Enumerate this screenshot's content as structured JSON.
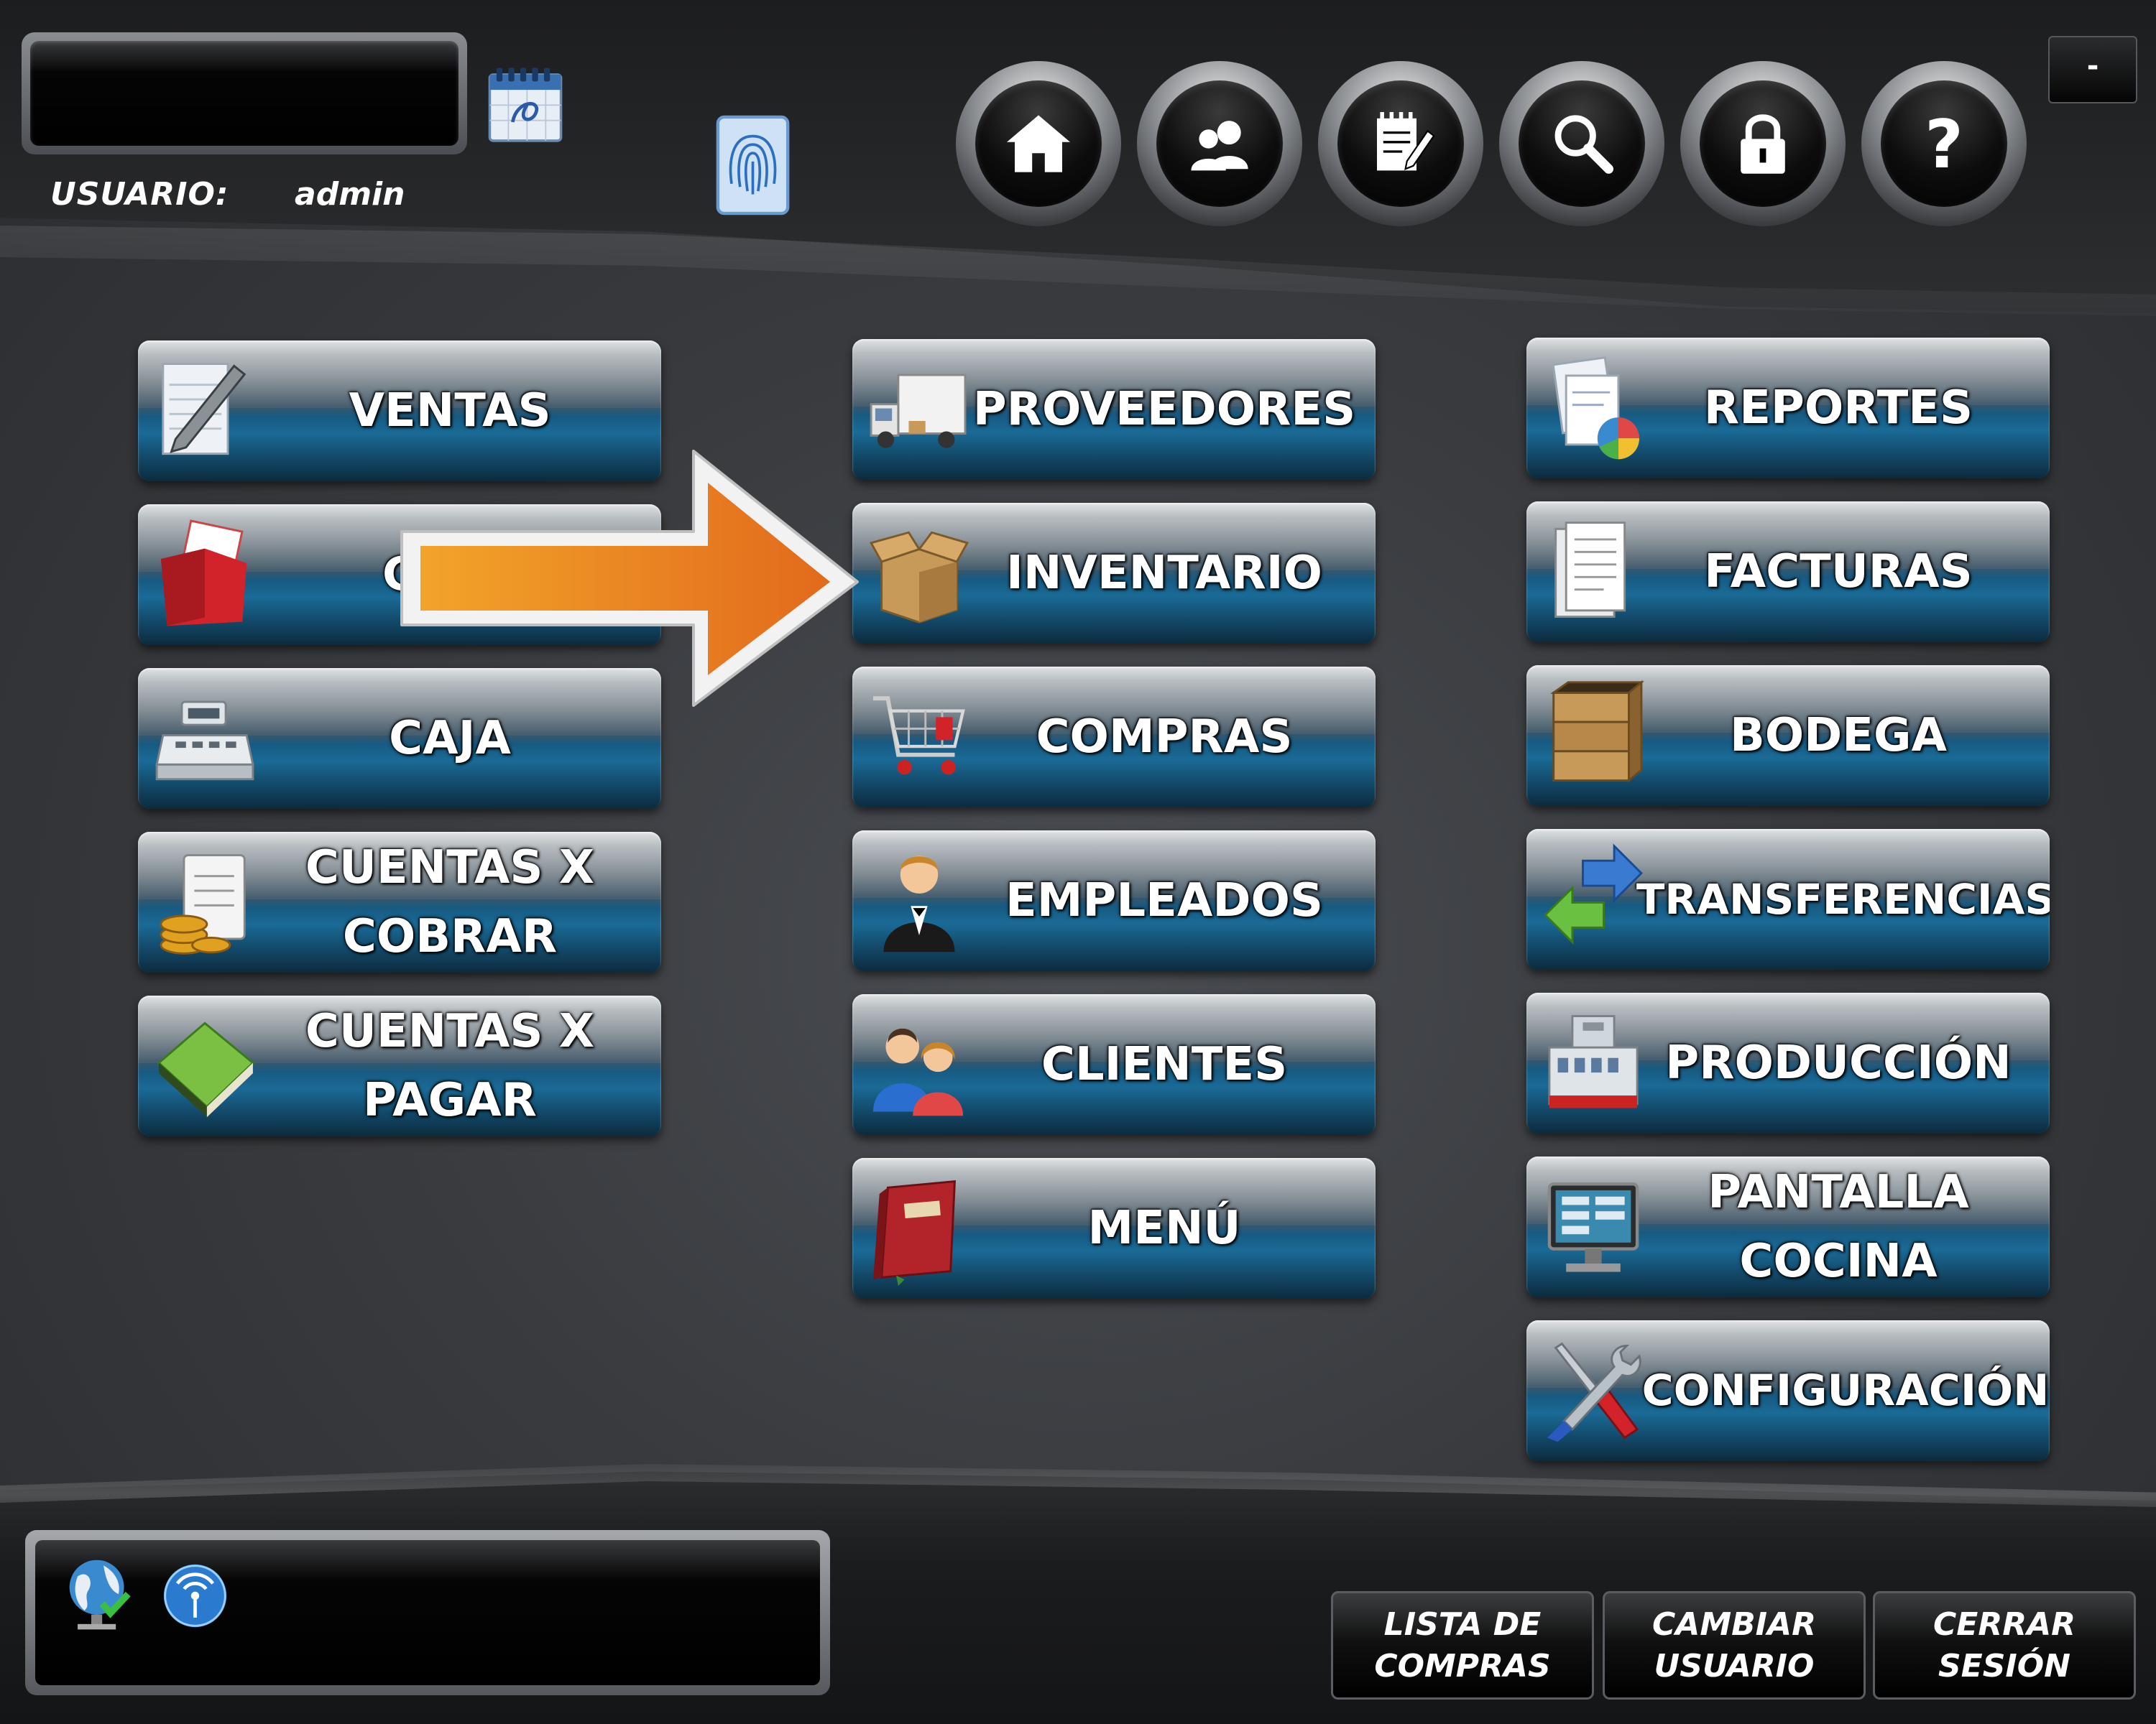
{
  "header": {
    "user_label": "USUARIO:",
    "user_value": "admin",
    "minimize_label": "-",
    "nav_buttons": [
      {
        "name": "home-icon"
      },
      {
        "name": "users-icon"
      },
      {
        "name": "notepad-icon"
      },
      {
        "name": "search-icon"
      },
      {
        "name": "lock-icon"
      },
      {
        "name": "help-icon",
        "glyph": "?"
      }
    ]
  },
  "menu": {
    "ventas": "VENTAS",
    "gastos": "GA",
    "caja": "CAJA",
    "cuentas_cobrar": "CUENTAS X\nCOBRAR",
    "cuentas_pagar": "CUENTAS X\nPAGAR",
    "proveedores": "PROVEEDORES",
    "inventario": "INVENTARIO",
    "compras": "COMPRAS",
    "empleados": "EMPLEADOS",
    "clientes": "CLIENTES",
    "menu": "MENÚ",
    "reportes": "REPORTES",
    "facturas": "FACTURAS",
    "bodega": "BODEGA",
    "transferencias": "TRANSFERENCIAS",
    "produccion": "PRODUCCIÓN",
    "pantalla_cocina": "PANTALLA\nCOCINA",
    "configuracion": "CONFIGURACIÓN"
  },
  "footer": {
    "lista_compras": "LISTA DE\nCOMPRAS",
    "cambiar_usuario": "CAMBIAR\nUSUARIO",
    "cerrar_sesion": "CERRAR\nSESIÓN"
  },
  "colors": {
    "tile_blue": "#1a6a96",
    "arrow_orange": "#e8861f",
    "background": "#3a3c40"
  }
}
